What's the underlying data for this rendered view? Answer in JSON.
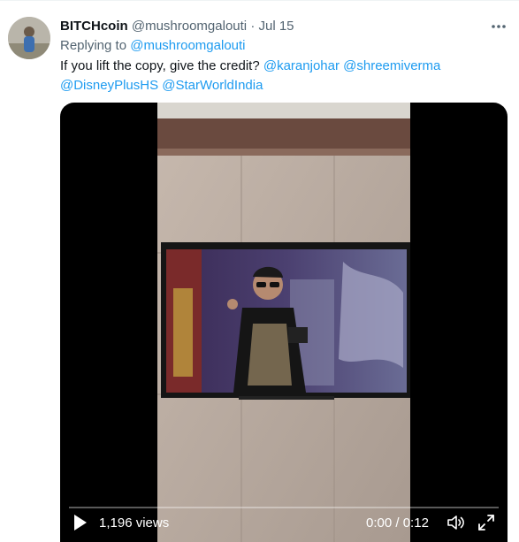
{
  "tweet": {
    "display_name": "BITCHcoin",
    "handle": "@mushroomgalouti",
    "separator": "·",
    "date": "Jul 15",
    "replying_prefix": "Replying to",
    "replying_handle": "@mushroomgalouti",
    "text_plain": "If you lift the copy, give the credit?",
    "mentions": [
      "@karanjohar",
      "@shreemiverma",
      "@DisneyPlusHS",
      "@StarWorldIndia"
    ]
  },
  "video": {
    "views": "1,196 views",
    "time_current": "0:00",
    "time_separator": "/",
    "time_total": "0:12",
    "progress": 0.0
  },
  "icons": {
    "more": "more-horizontal-icon",
    "play": "play-icon",
    "volume": "volume-icon",
    "fullscreen": "fullscreen-icon"
  },
  "colors": {
    "link": "#1d9bf0",
    "muted": "#536471",
    "text": "#0f1419"
  }
}
